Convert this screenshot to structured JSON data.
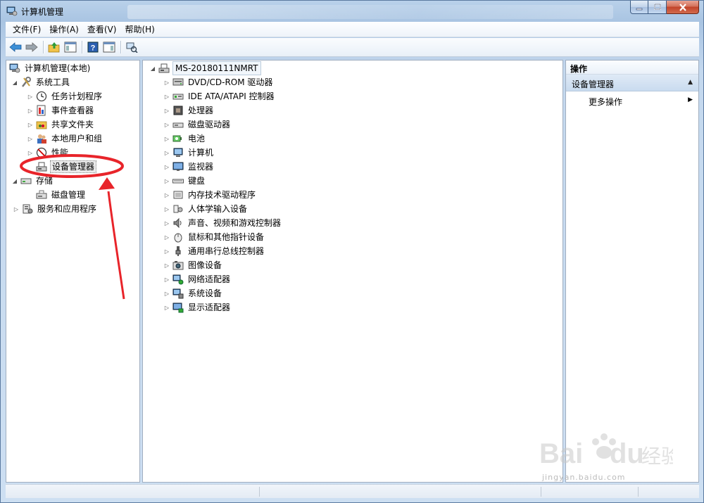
{
  "window": {
    "title": "计算机管理",
    "controls": {
      "minimize": "minimize",
      "maximize": "maximize",
      "close": "close"
    }
  },
  "menubar": {
    "items": [
      "文件(F)",
      "操作(A)",
      "查看(V)",
      "帮助(H)"
    ]
  },
  "toolbar": {
    "buttons": [
      "back-icon",
      "forward-icon",
      "up-folder-icon",
      "show-hide-tree-icon",
      "help-icon",
      "show-hide-action-icon",
      "properties-icon"
    ]
  },
  "left_tree": {
    "root": "计算机管理(本地)",
    "system_tools": "系统工具",
    "system_tools_children": [
      "任务计划程序",
      "事件查看器",
      "共享文件夹",
      "本地用户和组",
      "性能",
      "设备管理器"
    ],
    "storage": "存储",
    "storage_children": [
      "磁盘管理"
    ],
    "services": "服务和应用程序",
    "selected": "设备管理器"
  },
  "device_tree": {
    "root": "MS-20180111NMRT",
    "categories": [
      "DVD/CD-ROM 驱动器",
      "IDE ATA/ATAPI 控制器",
      "处理器",
      "磁盘驱动器",
      "电池",
      "计算机",
      "监视器",
      "键盘",
      "内存技术驱动程序",
      "人体学输入设备",
      "声音、视频和游戏控制器",
      "鼠标和其他指针设备",
      "通用串行总线控制器",
      "图像设备",
      "网络适配器",
      "系统设备",
      "显示适配器"
    ]
  },
  "actions": {
    "header": "操作",
    "section": "设备管理器",
    "more": "更多操作"
  },
  "annotation": {
    "color": "#e8242a"
  },
  "watermark": {
    "text": "jingyan.baidu.com",
    "brand": "Bai du 经验"
  }
}
